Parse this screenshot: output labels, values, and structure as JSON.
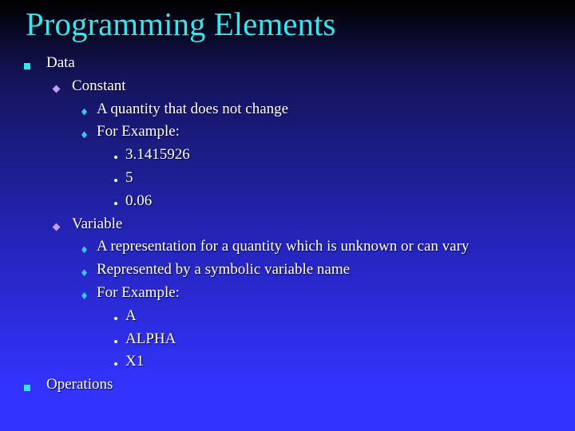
{
  "slide": {
    "title": "Programming Elements",
    "items": [
      {
        "level": 1,
        "text": "Data"
      },
      {
        "level": 2,
        "text": "Constant"
      },
      {
        "level": 3,
        "text": "A quantity that does not change"
      },
      {
        "level": 3,
        "text": "For Example:"
      },
      {
        "level": 4,
        "text": "3.1415926"
      },
      {
        "level": 4,
        "text": "5"
      },
      {
        "level": 4,
        "text": "0.06"
      },
      {
        "level": 2,
        "text": "Variable"
      },
      {
        "level": 3,
        "text": "A representation for a quantity which is unknown or can vary"
      },
      {
        "level": 3,
        "text": "Represented by a symbolic variable name"
      },
      {
        "level": 3,
        "text": "For Example:"
      },
      {
        "level": 4,
        "text": "A"
      },
      {
        "level": 4,
        "text": "ALPHA"
      },
      {
        "level": 4,
        "text": "X1"
      },
      {
        "level": 1,
        "text": "Operations"
      }
    ],
    "bullet_icons": {
      "1": "square-bullet-icon",
      "2": "diamond-bullet-icon",
      "3": "small-diamond-bullet-icon",
      "4": "dot-bullet-icon"
    },
    "colors": {
      "title": "#33e6f0",
      "level1_bullet": "#33e6f0",
      "level2_bullet": "#c59cf5",
      "level3_bullet": "#33c8f0",
      "text": "#ffffff",
      "background_bottom": "#3333ff"
    }
  }
}
